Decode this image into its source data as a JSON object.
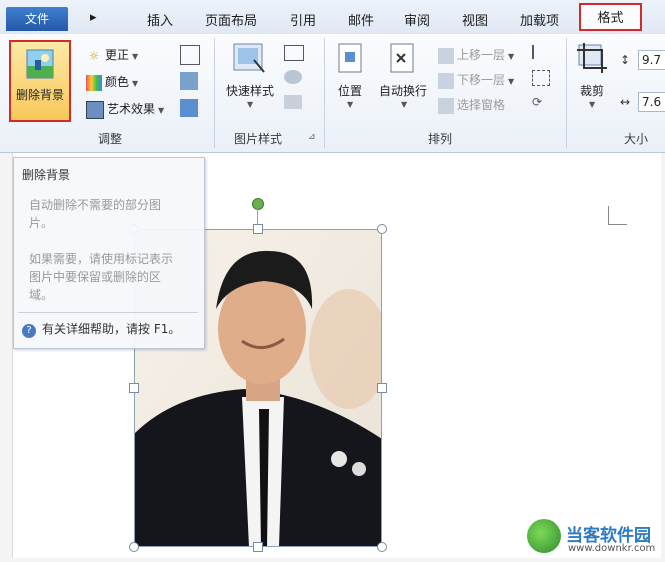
{
  "tabs": {
    "file": "文件",
    "items": [
      "插入",
      "页面布局",
      "引用",
      "邮件",
      "审阅",
      "视图",
      "加载项"
    ],
    "active": "格式"
  },
  "ribbon": {
    "adjust": {
      "remove_background": "删除背景",
      "corrections": "更正",
      "color": "颜色",
      "artistic_effects": "艺术效果",
      "label": "调整"
    },
    "picture_styles": {
      "quick_styles": "快速样式",
      "label": "图片样式"
    },
    "arrange": {
      "position": "位置",
      "wrap_text": "自动换行",
      "bring_forward": "上移一层",
      "send_backward": "下移一层",
      "selection_pane": "选择窗格",
      "label": "排列"
    },
    "size": {
      "crop": "裁剪",
      "height_value": "9.7",
      "width_value": "7.6",
      "label": "大小"
    }
  },
  "tooltip": {
    "title": "删除背景",
    "lines": [
      "自动删除不需要的部分图",
      "片。",
      "",
      "如果需要，请使用标记表示",
      "图片中要保留或删除的区",
      "域。"
    ],
    "help": "有关详细帮助，请按 F1。"
  },
  "watermark": {
    "name": "当客软件园",
    "url": "www.downkr.com"
  },
  "colors": {
    "highlight": "#d22b2b",
    "ribbon_bg": "#eaf0f8",
    "file_tab": "#2458a9"
  }
}
